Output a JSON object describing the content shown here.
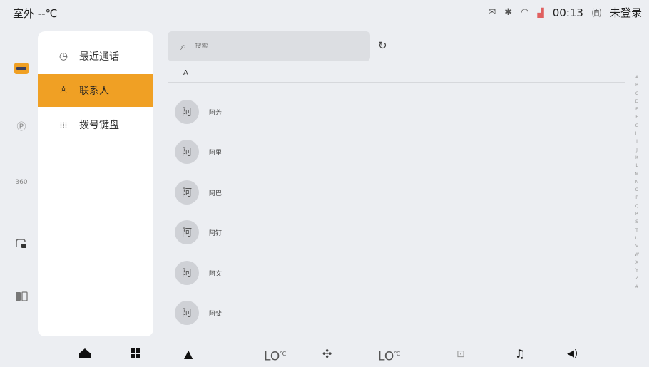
{
  "status": {
    "outdoor_temp": "室外 --℃",
    "message_icon": "✉",
    "bluetooth_icon": "✱",
    "wifi_icon": "◠",
    "signal_icon": "▟",
    "time": "00:13",
    "account_icon": "㉂",
    "login_status": "未登录"
  },
  "rail": [
    {
      "name": "phone-app-icon",
      "glyph": "▬"
    },
    {
      "name": "parking-app-icon",
      "glyph": "Ⓟ"
    },
    {
      "name": "view-360-app-icon",
      "glyph": "360"
    },
    {
      "name": "car-lock-app-icon",
      "glyph": "⊓"
    },
    {
      "name": "split-screen-app-icon",
      "glyph": "◫"
    }
  ],
  "menu": {
    "recent_calls": "最近通话",
    "contacts": "联系人",
    "dialpad": "拨号键盘",
    "recent_icon": "◷",
    "contacts_icon": "♙",
    "dialpad_icon": "⁞⁞⁞"
  },
  "search": {
    "placeholder": "搜索",
    "icon": "⌕",
    "refresh_icon": "↻"
  },
  "section_letter": "A",
  "contacts": [
    {
      "avatar": "阿",
      "name": "阿芳"
    },
    {
      "avatar": "阿",
      "name": "阿里"
    },
    {
      "avatar": "阿",
      "name": "阿巴"
    },
    {
      "avatar": "阿",
      "name": "阿钉"
    },
    {
      "avatar": "阿",
      "name": "阿文"
    },
    {
      "avatar": "阿",
      "name": "阿斐"
    }
  ],
  "alphabet": [
    "A",
    "B",
    "C",
    "D",
    "E",
    "F",
    "G",
    "H",
    "I",
    "J",
    "K",
    "L",
    "M",
    "N",
    "O",
    "P",
    "Q",
    "R",
    "S",
    "T",
    "U",
    "V",
    "W",
    "X",
    "Y",
    "Z",
    "#"
  ],
  "dock": {
    "home_icon": "⌂",
    "apps_icon": "⊞",
    "nav_icon": "▲",
    "left_temp": "LO",
    "temp_unit": "℃",
    "fan_icon": "✣",
    "right_temp": "LO",
    "screen_icon": "⊡",
    "music_icon": "♫",
    "volume_icon": "◀)"
  },
  "colors": {
    "accent": "#f0a024",
    "background": "#eceef2"
  }
}
